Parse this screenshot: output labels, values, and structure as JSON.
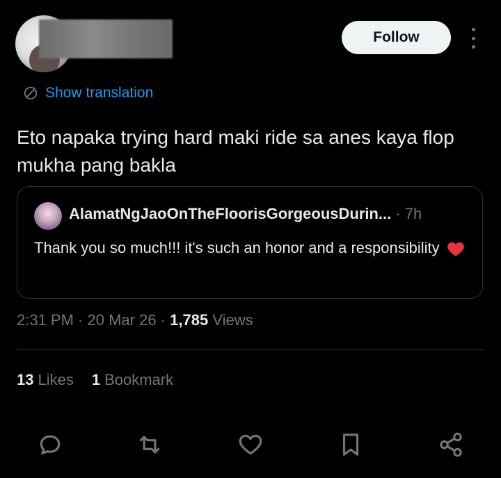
{
  "header": {
    "follow_label": "Follow"
  },
  "translation": {
    "label": "Show translation"
  },
  "tweet": {
    "text": "Eto napaka trying hard maki ride sa anes kaya flop mukha pang bakla"
  },
  "quote": {
    "author": "AlamatNgJaoOnTheFloorisGorgeousDurin...",
    "time": "· 7h",
    "text": "Thank you so much!!! it's such an honor and a responsibility"
  },
  "meta": {
    "time": "2:31 PM",
    "sep1": " · ",
    "date": "20 Mar 26",
    "sep2": " · ",
    "views_count": "1,785",
    "views_label": " Views"
  },
  "stats": {
    "likes_count": "13",
    "likes_label": "Likes",
    "bookmarks_count": "1",
    "bookmarks_label": "Bookmark"
  },
  "actions": [
    "reply-icon",
    "retweet-icon",
    "like-icon",
    "bookmark-icon",
    "share-icon"
  ],
  "colors": {
    "background": "#000000",
    "text": "#e7e9ea",
    "muted": "#71767b",
    "link": "#1d9bf0",
    "border": "#2f3336",
    "heart": "#f91880"
  }
}
